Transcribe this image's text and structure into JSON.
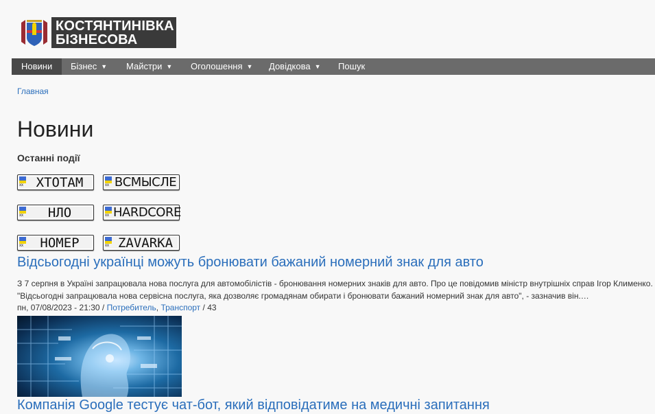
{
  "site": {
    "logo_line1": "КОСТЯНТИНІВКА",
    "logo_line2": "БІЗНЕСОВА"
  },
  "nav": {
    "items": [
      {
        "label": "Новини",
        "active": true,
        "dropdown": false
      },
      {
        "label": "Бізнес",
        "active": false,
        "dropdown": true
      },
      {
        "label": "Майстри",
        "active": false,
        "dropdown": true
      },
      {
        "label": "Оголошення",
        "active": false,
        "dropdown": true
      },
      {
        "label": "Довідкова",
        "active": false,
        "dropdown": true
      },
      {
        "label": "Пошук",
        "active": false,
        "dropdown": false
      }
    ]
  },
  "breadcrumb": "Главная",
  "page_title": "Новини",
  "section_title": "Останні події",
  "plates": {
    "region": "xx",
    "items": [
      "ХТОТАМ",
      "ВСМЫСЛЕ",
      "НЛО",
      "HARDCORE",
      "НОМЕР",
      "ZAVARKA"
    ]
  },
  "articles": [
    {
      "title": "Відсьогодні українці можуть бронювати бажаний номерний знак для авто",
      "body": "З 7 серпня в Україні запрацювала нова послуга для автомобілістів - бронювання номерних знаків для авто. Про це повідомив міністр внутрішніх справ Ігор Клименко. \"Відсьогодні запрацювала нова сервісна послуга, яка дозволяє громадянам обирати і бронювати бажаний номерний знак для авто\", - зазначив він.…",
      "date": "пн, 07/08/2023 - 21:30",
      "sep1": " / ",
      "category1": "Потребитель",
      "comma": ", ",
      "category2": "Транспорт",
      "sep2": " / ",
      "views": "43"
    },
    {
      "title": "Компанія Google тестує чат-бот, який відповідатиме на медичні запитання"
    }
  ],
  "colors": {
    "link": "#2a6ebb",
    "nav_bg": "#6b6b6b",
    "nav_active": "#494949",
    "logo_bg": "#3a3a3a"
  }
}
